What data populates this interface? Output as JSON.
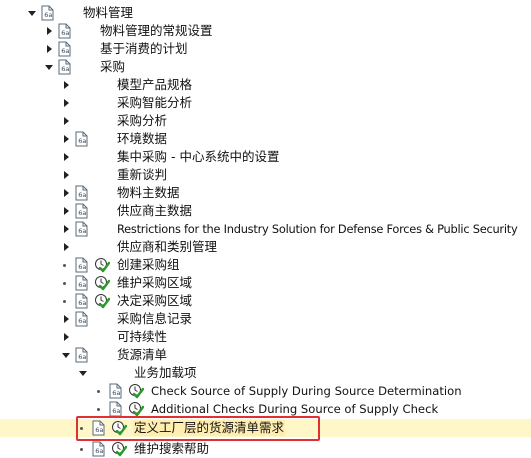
{
  "tree": {
    "nodes": [
      {
        "label": "物料管理",
        "expander": "expanded",
        "icon": "document-icon"
      },
      {
        "label": "物料管理的常规设置",
        "expander": "collapsed",
        "icon": "document-icon"
      },
      {
        "label": "基于消费的计划",
        "expander": "collapsed",
        "icon": "document-icon"
      },
      {
        "label": "采购",
        "expander": "expanded",
        "icon": "document-icon"
      },
      {
        "label": "模型产品规格",
        "expander": "collapsed"
      },
      {
        "label": "采购智能分析",
        "expander": "collapsed"
      },
      {
        "label": "采购分析",
        "expander": "collapsed"
      },
      {
        "label": "环境数据",
        "expander": "collapsed",
        "icon": "document-icon"
      },
      {
        "label": "集中采购 - 中心系统中的设置",
        "expander": "collapsed"
      },
      {
        "label": "重新谈判",
        "expander": "collapsed"
      },
      {
        "label": "物料主数据",
        "expander": "collapsed",
        "icon": "document-icon"
      },
      {
        "label": "供应商主数据",
        "expander": "collapsed",
        "icon": "document-icon"
      },
      {
        "label": "Restrictions for the Industry Solution for Defense Forces & Public Security",
        "expander": "collapsed",
        "icon": "document-icon"
      },
      {
        "label": "供应商和类别管理",
        "expander": "collapsed"
      },
      {
        "label": "创建采购组",
        "bullet": true,
        "icon": "document-icon",
        "action": "execute-clock-icon"
      },
      {
        "label": "维护采购区域",
        "bullet": true,
        "icon": "document-icon",
        "action": "execute-clock-icon"
      },
      {
        "label": "决定采购区域",
        "bullet": true,
        "icon": "document-icon",
        "action": "execute-clock-icon"
      },
      {
        "label": "采购信息记录",
        "expander": "collapsed",
        "icon": "document-icon"
      },
      {
        "label": "可持续性",
        "expander": "collapsed"
      },
      {
        "label": "货源清单",
        "expander": "expanded",
        "icon": "document-icon"
      },
      {
        "label": "业务加载项",
        "expander": "expanded"
      },
      {
        "label": "Check Source of Supply During Source Determination",
        "bullet": true,
        "icon": "document-icon",
        "action": "execute-clock-icon"
      },
      {
        "label": "Additional Checks During Source of Supply Check",
        "bullet": true,
        "icon": "document-icon",
        "action": "execute-clock-icon"
      },
      {
        "label": "定义工厂层的货源清单需求",
        "bullet": true,
        "icon": "document-icon",
        "action": "execute-clock-icon",
        "selected": true
      },
      {
        "label": "维护搜索帮助",
        "bullet": true,
        "icon": "document-icon",
        "action": "execute-clock-icon"
      }
    ]
  },
  "colors": {
    "selected_row": "#fff7c8",
    "highlight_border": "#e03030",
    "clock_green": "#2a9a2a"
  }
}
